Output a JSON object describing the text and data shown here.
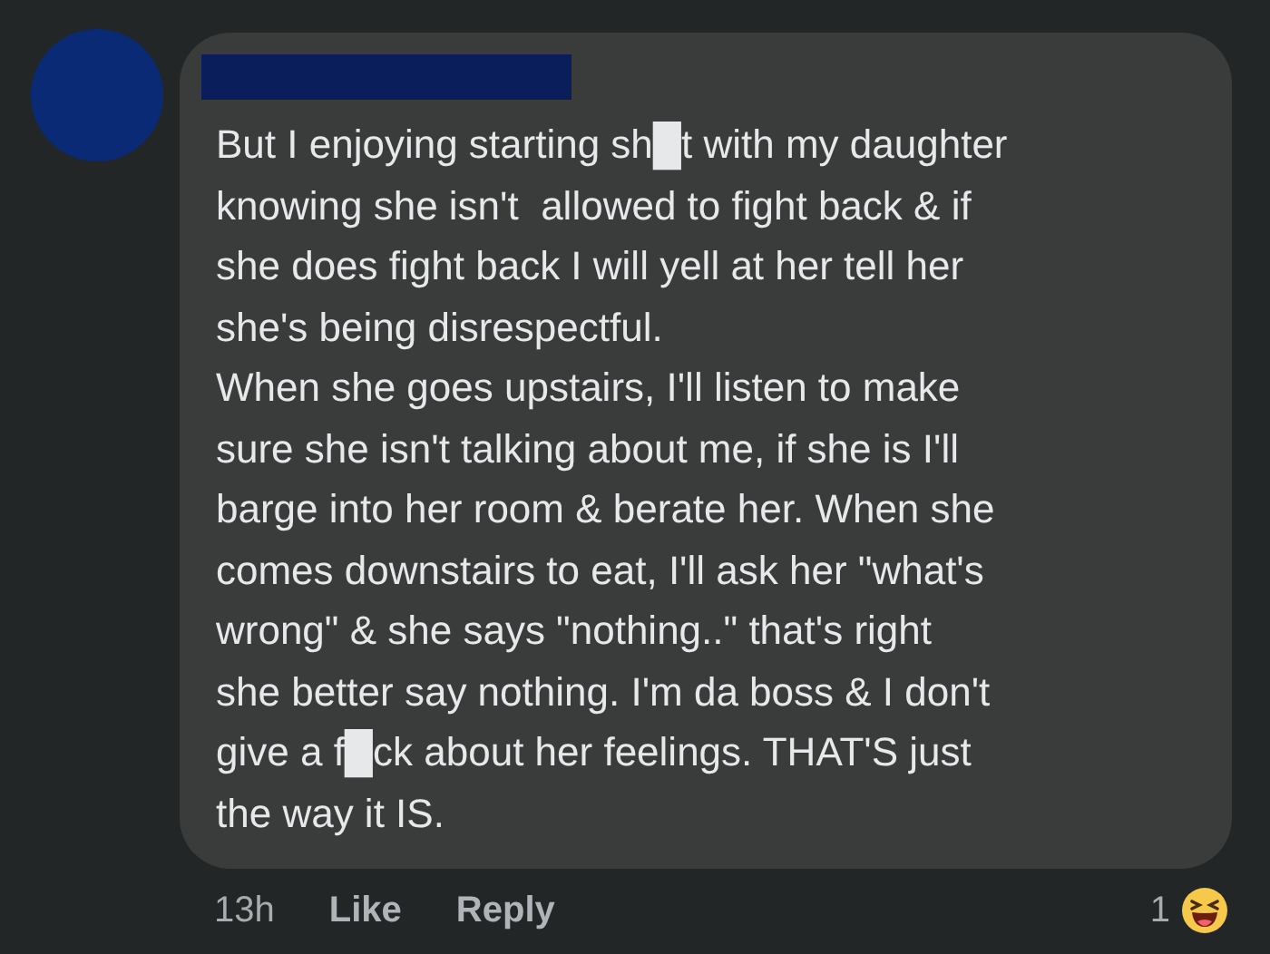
{
  "comment": {
    "paragraphs": [
      {
        "lines": [
          "But I enjoying starting sh█t with my daughter",
          "knowing she isn't  allowed to fight back & if",
          "she does fight back I will yell at her tell her",
          "she's being disrespectful."
        ]
      },
      {
        "lines": [
          "When she goes upstairs, I'll listen to make",
          "sure she isn't talking about me, if she is I'll",
          "barge into her room & berate her. When she",
          "comes downstairs to eat, I'll ask her \"what's",
          "wrong\" & she says \"nothing..\" that's right",
          "she better say nothing. I'm da boss & I don't",
          "give a f█ck about her feelings. THAT'S just",
          "the way it IS."
        ]
      }
    ],
    "time": "13h",
    "actions": [
      "Like",
      "Reply"
    ],
    "reaction_count": "1"
  }
}
